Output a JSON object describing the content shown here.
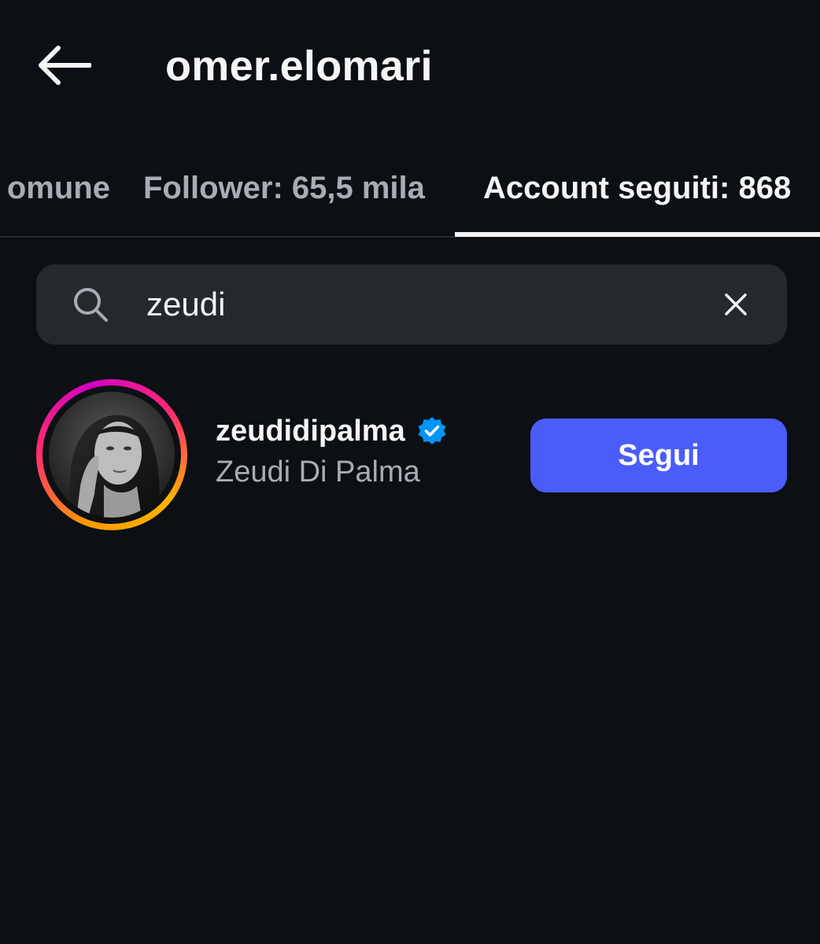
{
  "header": {
    "title": "omer.elomari"
  },
  "tabs": [
    {
      "label": "In comune",
      "visible_label": "omune"
    },
    {
      "label": "Follower: 65,5 mila"
    },
    {
      "label": "Account seguiti: 868"
    }
  ],
  "active_tab": 2,
  "search": {
    "value": "zeudi",
    "icon": "search-icon",
    "clear_icon": "close-icon"
  },
  "results": [
    {
      "username": "zeudidipalma",
      "full_name": "Zeudi Di Palma",
      "verified": true,
      "follow_label": "Segui"
    }
  ],
  "colors": {
    "background": "#0c1014",
    "search_bg": "#25292e",
    "button_blue": "#4a5df9",
    "verified_blue": "#0095f6",
    "secondary_text": "#a8adb3"
  }
}
